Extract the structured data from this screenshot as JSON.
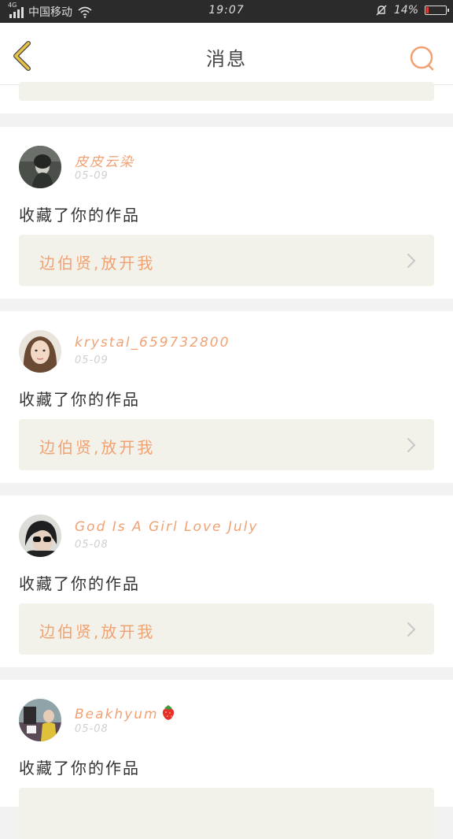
{
  "status_bar": {
    "network": "4G",
    "carrier": "中国移动",
    "time": "19:07",
    "battery": "14%",
    "battery_level": 0.14
  },
  "nav": {
    "title": "消息"
  },
  "notifications": [
    {
      "username": "皮皮云染",
      "date": "05-09",
      "action": "收藏了你的作品",
      "work_title": "边伯贤,放开我"
    },
    {
      "username": "krystal_659732800",
      "date": "05-09",
      "action": "收藏了你的作品",
      "work_title": "边伯贤,放开我"
    },
    {
      "username": "God Is A Girl Love July",
      "date": "05-08",
      "action": "收藏了你的作品",
      "work_title": "边伯贤,放开我"
    },
    {
      "username": "Beakhyum",
      "date": "05-08",
      "action": "收藏了你的作品",
      "work_title": ""
    }
  ],
  "colors": {
    "accent": "#f0a273",
    "back_arrow": "#e8c247",
    "work_box_bg": "#f3f2ea",
    "status_bar_bg": "#2b2b2b"
  },
  "icons": {
    "back": "chevron-left-icon",
    "search": "search-icon",
    "chevron": "chevron-right-icon",
    "emoji": "strawberry-icon"
  }
}
